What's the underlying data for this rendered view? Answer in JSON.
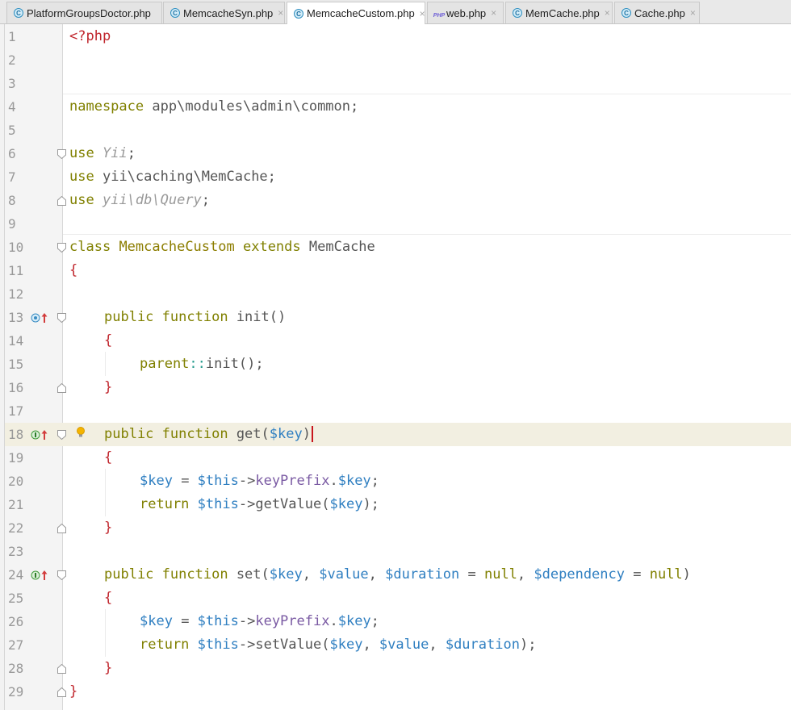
{
  "tabs": [
    {
      "label": "PlatformGroupsDoctor.php",
      "icon": "php-class-icon",
      "active": false
    },
    {
      "label": "MemcacheSyn.php",
      "icon": "php-class-icon",
      "active": false
    },
    {
      "label": "MemcacheCustom.php",
      "icon": "php-class-icon",
      "active": true
    },
    {
      "label": "web.php",
      "icon": "php-file-icon",
      "active": false
    },
    {
      "label": "MemCache.php",
      "icon": "php-class-icon",
      "active": false
    },
    {
      "label": "Cache.php",
      "icon": "php-class-icon",
      "active": false
    }
  ],
  "tab_close_glyph": "×",
  "editor": {
    "current_line": 18,
    "line_numbers": [
      "1",
      "2",
      "3",
      "4",
      "5",
      "6",
      "7",
      "8",
      "9",
      "10",
      "11",
      "12",
      "13",
      "14",
      "15",
      "16",
      "17",
      "18",
      "19",
      "20",
      "21",
      "22",
      "23",
      "24",
      "25",
      "26",
      "27",
      "28",
      "29"
    ],
    "code": {
      "l1": {
        "open": "<?php"
      },
      "l4": {
        "kw": "namespace",
        "name": "app\\modules\\admin\\common",
        "end": ";"
      },
      "l6": {
        "kw": "use",
        "name": "Yii",
        "end": ";"
      },
      "l7": {
        "kw": "use",
        "name": "yii\\caching\\MemCache",
        "end": ";"
      },
      "l8": {
        "kw": "use",
        "name": "yii\\db\\Query",
        "end": ";"
      },
      "l10": {
        "kw": "class",
        "name": "MemcacheCustom",
        "kw2": "extends",
        "parent": "MemCache"
      },
      "l11": {
        "brace": "{"
      },
      "l13": {
        "mod": "public",
        "kw": "function",
        "name": "init",
        "args": "()"
      },
      "l14": {
        "brace": "{"
      },
      "l15": {
        "kw": "parent",
        "op": "::",
        "call": "init",
        "end": "();"
      },
      "l16": {
        "brace": "}"
      },
      "l18": {
        "mod": "public",
        "kw": "function",
        "name": "get",
        "open": "(",
        "arg": "$key",
        "close": ")"
      },
      "l19": {
        "brace": "{"
      },
      "l20": {
        "var": "$key",
        "eq": " = ",
        "this": "$this",
        "arrow": "->",
        "field": "keyPrefix",
        "dot": ".",
        "var2": "$key",
        "end": ";"
      },
      "l21": {
        "kw": "return",
        "this": "$this",
        "arrow": "->",
        "call": "getValue",
        "open": "(",
        "arg": "$key",
        "end": ");"
      },
      "l22": {
        "brace": "}"
      },
      "l24": {
        "mod": "public",
        "kw": "function",
        "name": "set",
        "open": "(",
        "a1": "$key",
        "c1": ", ",
        "a2": "$value",
        "c2": ", ",
        "a3": "$duration",
        "eq1": " = ",
        "n1": "null",
        "c3": ", ",
        "a4": "$dependency",
        "eq2": " = ",
        "n2": "null",
        "close": ")"
      },
      "l25": {
        "brace": "{"
      },
      "l26": {
        "var": "$key",
        "eq": " = ",
        "this": "$this",
        "arrow": "->",
        "field": "keyPrefix",
        "dot": ".",
        "var2": "$key",
        "end": ";"
      },
      "l27": {
        "kw": "return",
        "this": "$this",
        "arrow": "->",
        "call": "setValue",
        "open": "(",
        "a1": "$key",
        "c1": ", ",
        "a2": "$value",
        "c2": ", ",
        "a3": "$duration",
        "end": ");"
      },
      "l28": {
        "brace": "}"
      },
      "l29": {
        "brace": "}"
      }
    }
  },
  "colors": {
    "keyword": "#808000",
    "variable": "#2f7fc1",
    "field": "#7a5aa3",
    "php_tag": "#c0262d",
    "current_line_bg": "#f2efe1"
  }
}
